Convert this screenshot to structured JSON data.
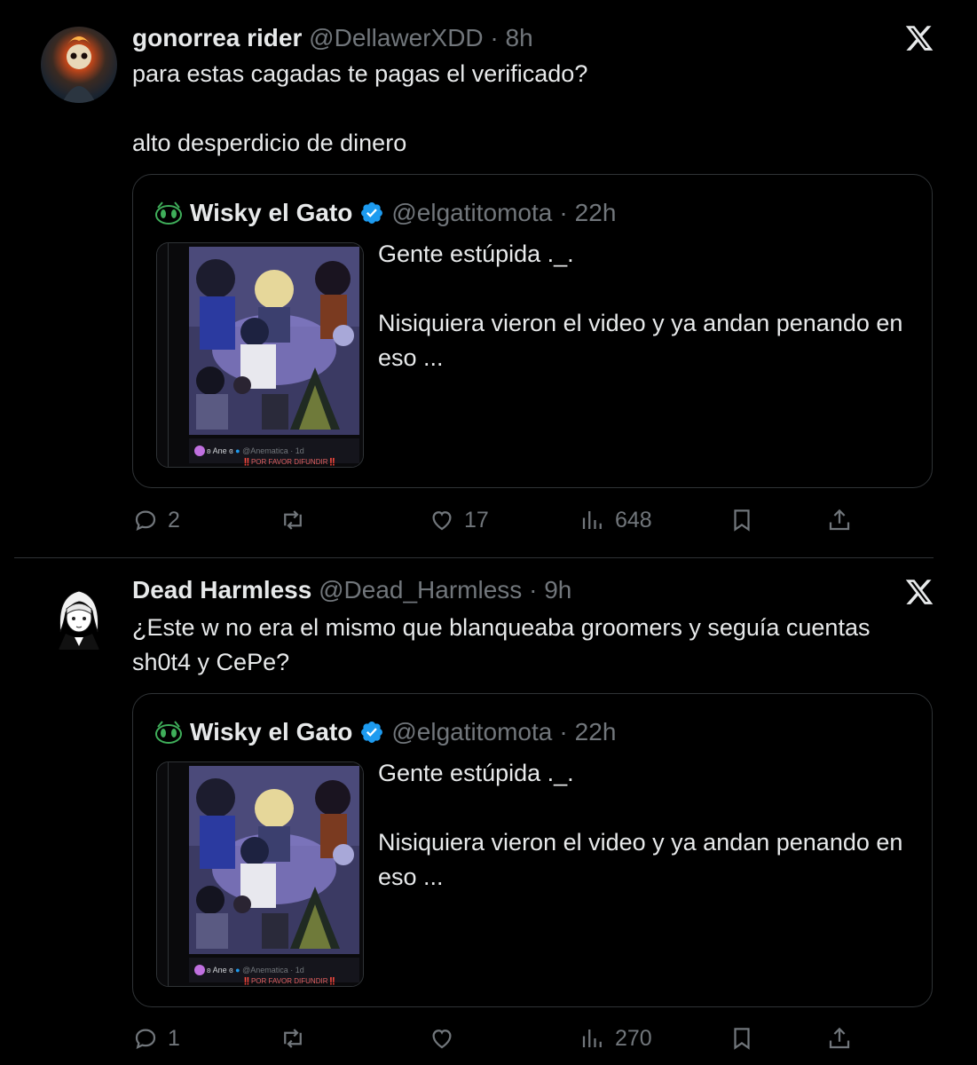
{
  "replies": [
    {
      "author_name": "gonorrea rider",
      "handle": "@DellawerXDD",
      "sep": "·",
      "time": "8h",
      "text": "para estas cagadas te pagas el verificado?\n\nalto desperdicio de dinero",
      "quote": {
        "author_name": "Wisky el Gato",
        "handle": "@elgatitomota",
        "sep": "·",
        "time": "22h",
        "text": "Gente estúpida ._.\n\nNisiquiera vieron el video y ya andan penando en eso ...",
        "media_author": "ʚ Ane ɞ",
        "media_handle": "@Anematica · 1d",
        "media_caption": "‼️POR FAVOR DIFUNDIR‼️"
      },
      "actions": {
        "replies": "2",
        "reposts": "",
        "likes": "17",
        "views": "648"
      }
    },
    {
      "author_name": "Dead Harmless",
      "handle": "@Dead_Harmless",
      "sep": "·",
      "time": "9h",
      "text": "¿Este w no era el mismo que blanqueaba groomers y seguía cuentas sh0t4 y CePe?",
      "quote": {
        "author_name": "Wisky el Gato",
        "handle": "@elgatitomota",
        "sep": "·",
        "time": "22h",
        "text": "Gente estúpida ._.\n\nNisiquiera vieron el video y ya andan penando en eso ...",
        "media_author": "ʚ Ane ɞ",
        "media_handle": "@Anematica · 1d",
        "media_caption": "‼️POR FAVOR DIFUNDIR‼️"
      },
      "actions": {
        "replies": "1",
        "reposts": "",
        "likes": "",
        "views": "270"
      }
    }
  ],
  "icons": {
    "reply": "speech-bubble-icon",
    "repost": "repost-arrows-icon",
    "like": "heart-icon",
    "views": "bar-chart-icon",
    "bookmark": "bookmark-icon",
    "share": "share-upload-icon",
    "close": "x-logo-icon",
    "verified": "verified-badge-icon"
  },
  "colors": {
    "background": "#000000",
    "text": "#e7e9ea",
    "muted": "#71767b",
    "border": "#2f3336",
    "verified": "#1d9bf0"
  }
}
